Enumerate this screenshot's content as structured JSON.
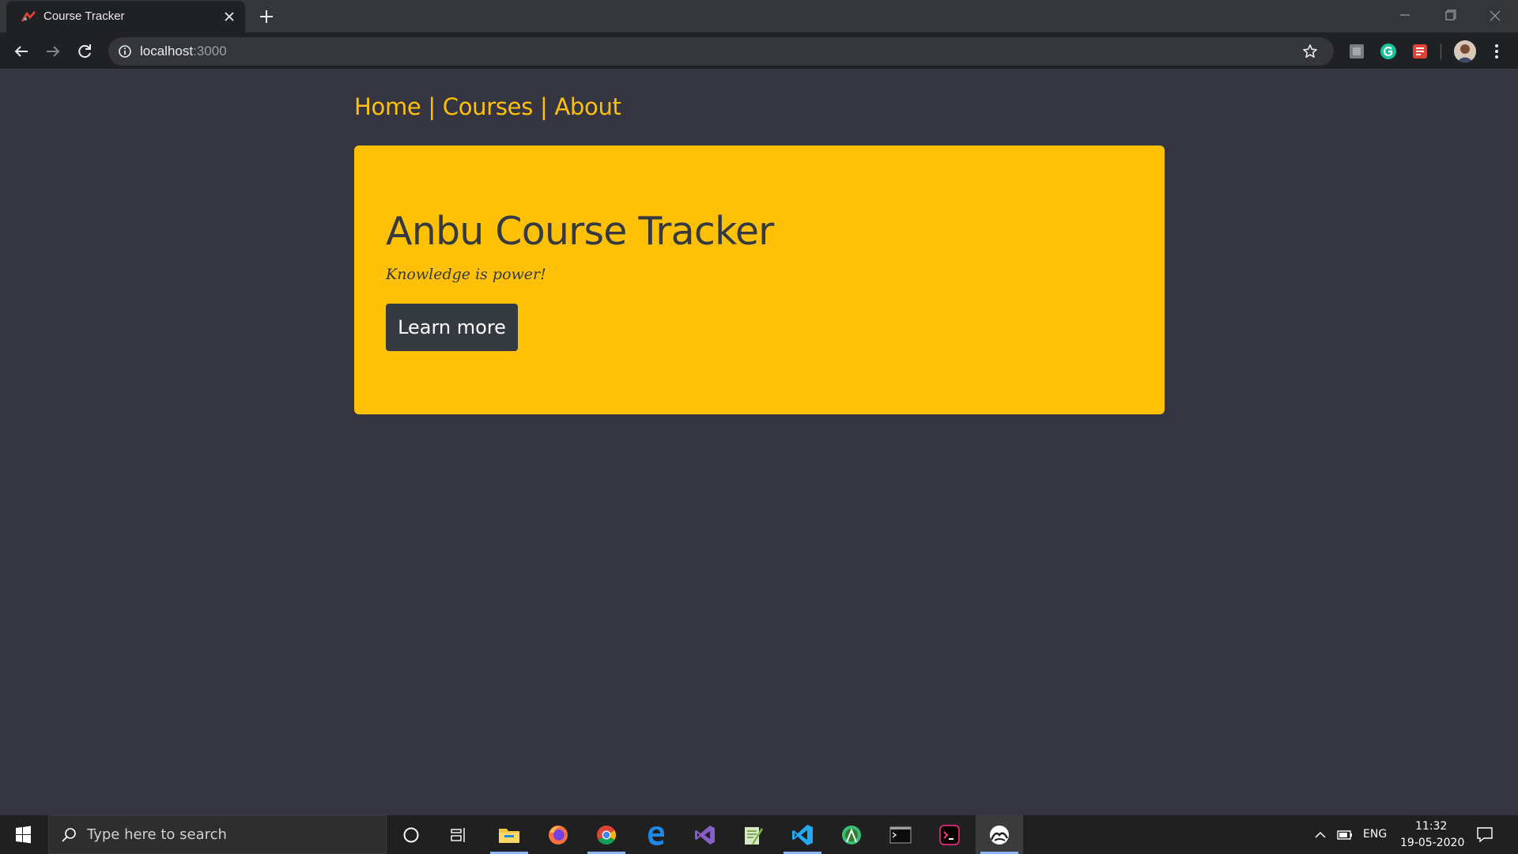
{
  "browser": {
    "tab_title": "Course Tracker",
    "url_host": "localhost",
    "url_port": ":3000"
  },
  "site": {
    "nav": {
      "home": "Home",
      "courses": "Courses",
      "about": "About",
      "separator": "|"
    },
    "hero": {
      "title": "Anbu Course Tracker",
      "lead": "Knowledge is power!",
      "button_label": "Learn more"
    }
  },
  "taskbar": {
    "search_placeholder": "Type here to search",
    "language": "ENG",
    "time": "11:32",
    "date": "19-05-2020",
    "apps": [
      "cortana-icon",
      "task-view-icon",
      "file-explorer-icon",
      "firefox-icon",
      "chrome-icon",
      "edge-icon",
      "visual-studio-icon",
      "notepad-plus-icon",
      "vscode-icon",
      "android-studio-icon",
      "terminal-icon",
      "hyper-terminal-icon",
      "paint-app-icon"
    ]
  },
  "colors": {
    "page_background": "#343541",
    "accent": "#ffc107",
    "dark": "#343a40"
  }
}
